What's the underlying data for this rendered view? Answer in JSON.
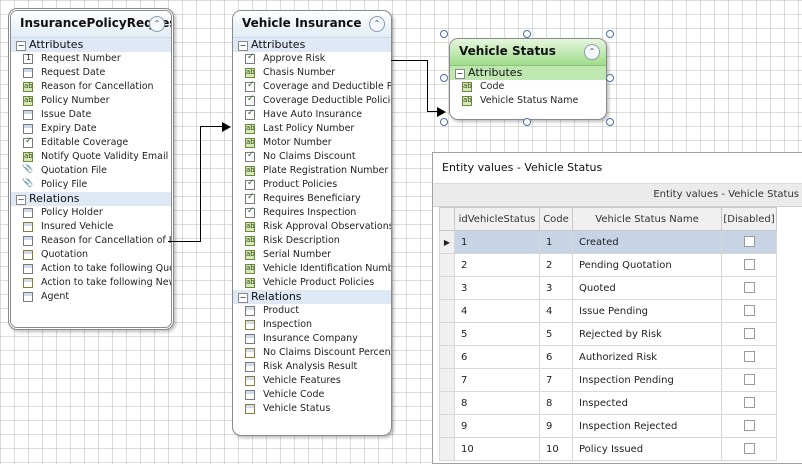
{
  "entities": {
    "policy": {
      "title": "InsurancePolicyRequest",
      "attributes_label": "Attributes",
      "attributes": [
        {
          "label": "Request Number",
          "icon": "number-icon"
        },
        {
          "label": "Request Date",
          "icon": "date-icon"
        },
        {
          "label": "Reason for Cancellation",
          "icon": "text-icon"
        },
        {
          "label": "Policy Number",
          "icon": "text-icon"
        },
        {
          "label": "Issue Date",
          "icon": "date-icon"
        },
        {
          "label": "Expiry Date",
          "icon": "date-icon"
        },
        {
          "label": "Editable Coverage",
          "icon": "checkbox-icon"
        },
        {
          "label": "Notify Quote Validity Email",
          "icon": "text-icon"
        },
        {
          "label": "Quotation File",
          "icon": "attachment-icon"
        },
        {
          "label": "Policy File",
          "icon": "attachment-icon"
        }
      ],
      "relations_label": "Relations",
      "relations": [
        "Policy Holder",
        "Insured Vehicle",
        "Reason for Cancellation of Ins",
        "Quotation",
        "Action to take following Quotat",
        "Action to take following New Q",
        "Agent"
      ]
    },
    "vehicle": {
      "title": "Vehicle Insurance",
      "attributes_label": "Attributes",
      "attributes": [
        {
          "label": "Approve Risk",
          "icon": "checkbox-icon"
        },
        {
          "label": "Chasis Number",
          "icon": "text-icon"
        },
        {
          "label": "Coverage and Deductible Polic",
          "icon": "checkbox-icon"
        },
        {
          "label": "Coverage Deductible Policies",
          "icon": "checkbox-icon"
        },
        {
          "label": "Have Auto Insurance",
          "icon": "checkbox-icon"
        },
        {
          "label": "Last Policy Number",
          "icon": "text-icon"
        },
        {
          "label": "Motor Number",
          "icon": "text-icon"
        },
        {
          "label": "No Claims Discount",
          "icon": "checkbox-icon"
        },
        {
          "label": "Plate Registration Number",
          "icon": "text-icon"
        },
        {
          "label": "Product Policies",
          "icon": "checkbox-icon"
        },
        {
          "label": "Requires Beneficiary",
          "icon": "checkbox-icon"
        },
        {
          "label": "Requires Inspection",
          "icon": "checkbox-icon"
        },
        {
          "label": "Risk Approval Observations",
          "icon": "text-icon"
        },
        {
          "label": "Risk Description",
          "icon": "text-icon"
        },
        {
          "label": "Serial Number",
          "icon": "text-icon"
        },
        {
          "label": "Vehicle Identification Numbe",
          "icon": "text-icon"
        },
        {
          "label": "Vehicle Product Policies",
          "icon": "text-icon"
        }
      ],
      "relations_label": "Relations",
      "relations": [
        "Product",
        "Inspection",
        "Insurance Company",
        "No Claims Discount Percentag",
        "Risk Analysis Result",
        "Vehicle Features",
        "Vehicle Code",
        "Vehicle Status"
      ]
    },
    "status": {
      "title": "Vehicle Status",
      "attributes_label": "Attributes",
      "attributes": [
        {
          "label": "Code",
          "icon": "text-icon"
        },
        {
          "label": "Vehicle Status Name",
          "icon": "text-icon"
        }
      ]
    }
  },
  "entity_values": {
    "window_title": "Entity values - Vehicle Status",
    "panel_caption": "Entity values - Vehicle Status",
    "columns": [
      "idVehicleStatus",
      "Code",
      "Vehicle Status Name",
      "[Disabled]"
    ],
    "rows": [
      {
        "id": "1",
        "code": "1",
        "name": "Created"
      },
      {
        "id": "2",
        "code": "2",
        "name": "Pending Quotation"
      },
      {
        "id": "3",
        "code": "3",
        "name": "Quoted"
      },
      {
        "id": "4",
        "code": "4",
        "name": "Issue Pending"
      },
      {
        "id": "5",
        "code": "5",
        "name": "Rejected by Risk"
      },
      {
        "id": "6",
        "code": "6",
        "name": "Authorized Risk"
      },
      {
        "id": "7",
        "code": "7",
        "name": "Inspection Pending"
      },
      {
        "id": "8",
        "code": "8",
        "name": "Inspected"
      },
      {
        "id": "9",
        "code": "9",
        "name": "Inspection Rejected"
      },
      {
        "id": "10",
        "code": "10",
        "name": "Policy Issued"
      }
    ],
    "current_row_indicator": "▶"
  },
  "colors": {
    "status_header": "#9fdc8a",
    "default_header": "#e2ecf5",
    "selection": "#c6d4e6"
  }
}
